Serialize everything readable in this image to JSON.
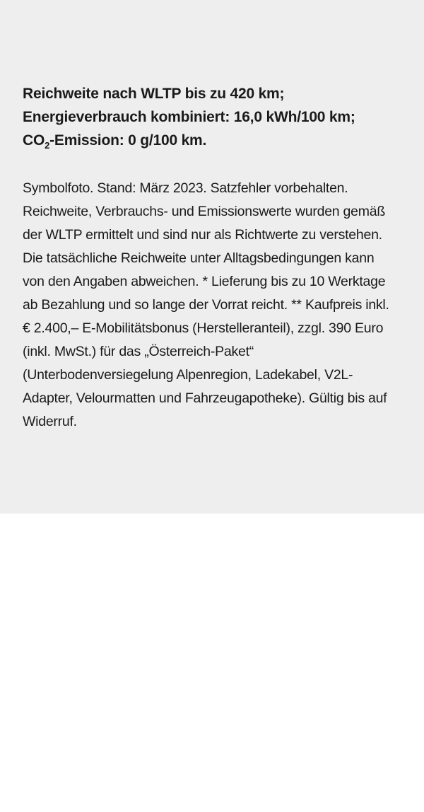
{
  "specs": {
    "range": "Reichweite nach WLTP bis zu 420 km;",
    "consumption": "Energieverbrauch kombiniert: 16,0 kWh/100 km;",
    "co2_prefix": "CO",
    "co2_subscript": "2",
    "co2_suffix": "-Emission: 0 g/100 km."
  },
  "disclaimer": "Symbolfoto. Stand: März 2023. Satzfehler vorbehalten. Reichweite, Verbrauchs- und Emissionswerte wurden gemäß der WLTP ermittelt und sind nur als Richtwerte zu verstehen. Die tatsächliche Reichweite unter Alltagsbedingungen kann von den Angaben abweichen. * Lieferung bis zu 10 Werktage ab Bezahlung und so lange der Vorrat reicht. ** Kaufpreis inkl. € 2.400,– E-Mobilitätsbonus (Herstelleranteil), zzgl. 390 Euro (inkl. MwSt.) für das „Österreich-Paket“ (Unterbodenversiegelung Alpenregion, Ladekabel, V2L-Adapter, Velourmatten und Fahrzeugapotheke). Gültig bis auf Widerruf."
}
